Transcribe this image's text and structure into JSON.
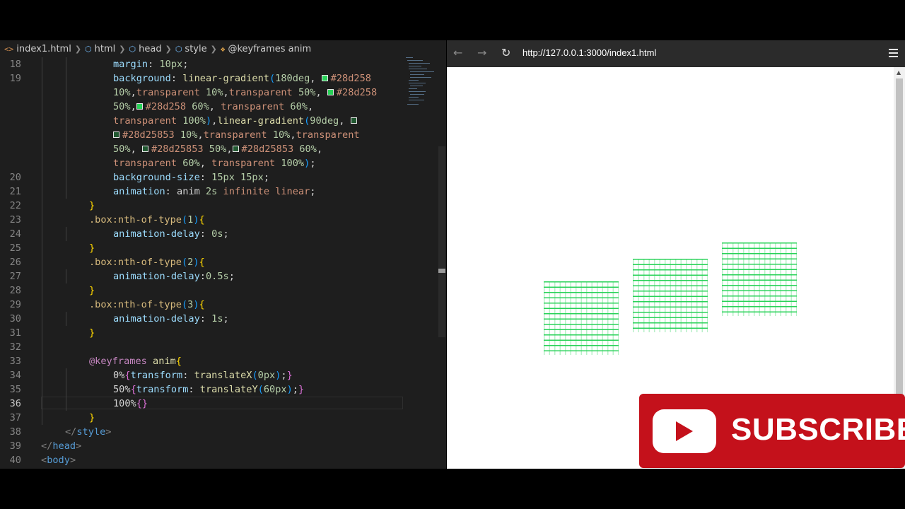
{
  "breadcrumb": {
    "file": "index1.html",
    "items": [
      "html",
      "head",
      "style",
      "@keyframes anim"
    ]
  },
  "browser": {
    "url": "http://127.0.0.1:3000/index1.html",
    "back": "←",
    "forward": "→",
    "reload": "↻"
  },
  "subscribe": {
    "label": "SUBSCRIBE"
  },
  "colors": {
    "accent_green": "#28d258",
    "subscribe_red": "#c4111b"
  },
  "code": {
    "lines": [
      {
        "no": "18",
        "cont": false,
        "indent": 3,
        "tokens": [
          [
            "prop",
            "margin"
          ],
          [
            "plain",
            ": "
          ],
          [
            "num",
            "10px"
          ],
          [
            "plain",
            ";"
          ]
        ]
      },
      {
        "no": "19",
        "cont": false,
        "indent": 3,
        "tokens": [
          [
            "prop",
            "background"
          ],
          [
            "plain",
            ": "
          ],
          [
            "fn",
            "linear-gradient"
          ],
          [
            "b3",
            "("
          ],
          [
            "num",
            "180deg"
          ],
          [
            "plain",
            ", "
          ],
          [
            "swatch",
            "#28d258"
          ],
          [
            "val",
            "#28d258"
          ]
        ]
      },
      {
        "no": "",
        "cont": true,
        "indent": 3,
        "tokens": [
          [
            "num",
            "10%"
          ],
          [
            "plain",
            ","
          ],
          [
            "val",
            "transparent "
          ],
          [
            "num",
            "10%"
          ],
          [
            "plain",
            ","
          ],
          [
            "val",
            "transparent "
          ],
          [
            "num",
            "50%"
          ],
          [
            "plain",
            ", "
          ],
          [
            "swatch",
            "#28d258"
          ],
          [
            "val",
            "#28d258"
          ]
        ]
      },
      {
        "no": "",
        "cont": true,
        "indent": 3,
        "tokens": [
          [
            "num",
            "50%"
          ],
          [
            "plain",
            ","
          ],
          [
            "swatch",
            "#28d258"
          ],
          [
            "val",
            "#28d258 "
          ],
          [
            "num",
            "60%"
          ],
          [
            "plain",
            ", "
          ],
          [
            "val",
            "transparent "
          ],
          [
            "num",
            "60%"
          ],
          [
            "plain",
            ","
          ]
        ]
      },
      {
        "no": "",
        "cont": true,
        "indent": 3,
        "tokens": [
          [
            "val",
            "transparent "
          ],
          [
            "num",
            "100%"
          ],
          [
            "b3",
            ")"
          ],
          [
            "plain",
            ","
          ],
          [
            "fn",
            "linear-gradient"
          ],
          [
            "b3",
            "("
          ],
          [
            "num",
            "90deg"
          ],
          [
            "plain",
            ", "
          ],
          [
            "swatch",
            "#28d25853"
          ]
        ]
      },
      {
        "no": "",
        "cont": true,
        "indent": 3,
        "tokens": [
          [
            "swatch",
            "#28d25853"
          ],
          [
            "val",
            "#28d25853 "
          ],
          [
            "num",
            "10%"
          ],
          [
            "plain",
            ","
          ],
          [
            "val",
            "transparent "
          ],
          [
            "num",
            "10%"
          ],
          [
            "plain",
            ","
          ],
          [
            "val",
            "transparent"
          ]
        ]
      },
      {
        "no": "",
        "cont": true,
        "indent": 3,
        "tokens": [
          [
            "num",
            "50%"
          ],
          [
            "plain",
            ", "
          ],
          [
            "swatch",
            "#28d25853"
          ],
          [
            "val",
            "#28d25853 "
          ],
          [
            "num",
            "50%"
          ],
          [
            "plain",
            ","
          ],
          [
            "swatch",
            "#28d25853"
          ],
          [
            "val",
            "#28d25853 "
          ],
          [
            "num",
            "60%"
          ],
          [
            "plain",
            ","
          ]
        ]
      },
      {
        "no": "",
        "cont": true,
        "indent": 3,
        "tokens": [
          [
            "val",
            "transparent "
          ],
          [
            "num",
            "60%"
          ],
          [
            "plain",
            ", "
          ],
          [
            "val",
            "transparent "
          ],
          [
            "num",
            "100%"
          ],
          [
            "b3",
            ")"
          ],
          [
            "plain",
            ";"
          ]
        ]
      },
      {
        "no": "20",
        "cont": false,
        "indent": 3,
        "tokens": [
          [
            "prop",
            "background-size"
          ],
          [
            "plain",
            ": "
          ],
          [
            "num",
            "15px 15px"
          ],
          [
            "plain",
            ";"
          ]
        ]
      },
      {
        "no": "21",
        "cont": false,
        "indent": 3,
        "tokens": [
          [
            "prop",
            "animation"
          ],
          [
            "plain",
            ": "
          ],
          [
            "plain",
            "anim "
          ],
          [
            "num",
            "2s "
          ],
          [
            "val",
            "infinite linear"
          ],
          [
            "plain",
            ";"
          ]
        ]
      },
      {
        "no": "22",
        "cont": false,
        "indent": 2,
        "tokens": [
          [
            "b1",
            "}"
          ]
        ]
      },
      {
        "no": "23",
        "cont": false,
        "indent": 2,
        "tokens": [
          [
            "sel",
            ".box:nth-of-type"
          ],
          [
            "b3",
            "("
          ],
          [
            "num",
            "1"
          ],
          [
            "b3",
            ")"
          ],
          [
            "b1",
            "{"
          ]
        ]
      },
      {
        "no": "24",
        "cont": false,
        "indent": 3,
        "tokens": [
          [
            "prop",
            "animation-delay"
          ],
          [
            "plain",
            ": "
          ],
          [
            "num",
            "0s"
          ],
          [
            "plain",
            ";"
          ]
        ]
      },
      {
        "no": "25",
        "cont": false,
        "indent": 2,
        "tokens": [
          [
            "b1",
            "}"
          ]
        ]
      },
      {
        "no": "26",
        "cont": false,
        "indent": 2,
        "tokens": [
          [
            "sel",
            ".box:nth-of-type"
          ],
          [
            "b3",
            "("
          ],
          [
            "num",
            "2"
          ],
          [
            "b3",
            ")"
          ],
          [
            "b1",
            "{"
          ]
        ]
      },
      {
        "no": "27",
        "cont": false,
        "indent": 3,
        "tokens": [
          [
            "prop",
            "animation-delay"
          ],
          [
            "plain",
            ":"
          ],
          [
            "num",
            "0.5s"
          ],
          [
            "plain",
            ";"
          ]
        ]
      },
      {
        "no": "28",
        "cont": false,
        "indent": 2,
        "tokens": [
          [
            "b1",
            "}"
          ]
        ]
      },
      {
        "no": "29",
        "cont": false,
        "indent": 2,
        "tokens": [
          [
            "sel",
            ".box:nth-of-type"
          ],
          [
            "b3",
            "("
          ],
          [
            "num",
            "3"
          ],
          [
            "b3",
            ")"
          ],
          [
            "b1",
            "{"
          ]
        ]
      },
      {
        "no": "30",
        "cont": false,
        "indent": 3,
        "tokens": [
          [
            "prop",
            "animation-delay"
          ],
          [
            "plain",
            ": "
          ],
          [
            "num",
            "1s"
          ],
          [
            "plain",
            ";"
          ]
        ]
      },
      {
        "no": "31",
        "cont": false,
        "indent": 2,
        "tokens": [
          [
            "b1",
            "}"
          ]
        ]
      },
      {
        "no": "32",
        "cont": false,
        "indent": 2,
        "tokens": []
      },
      {
        "no": "33",
        "cont": false,
        "indent": 2,
        "tokens": [
          [
            "kw",
            "@keyframes "
          ],
          [
            "fn",
            "anim"
          ],
          [
            "b1",
            "{"
          ]
        ]
      },
      {
        "no": "34",
        "cont": false,
        "indent": 3,
        "tokens": [
          [
            "plain",
            "0%"
          ],
          [
            "b2",
            "{"
          ],
          [
            "prop",
            "transform"
          ],
          [
            "plain",
            ": "
          ],
          [
            "fn",
            "translateX"
          ],
          [
            "b3",
            "("
          ],
          [
            "num",
            "0px"
          ],
          [
            "b3",
            ")"
          ],
          [
            "plain",
            ";"
          ],
          [
            "b2",
            "}"
          ]
        ]
      },
      {
        "no": "35",
        "cont": false,
        "indent": 3,
        "tokens": [
          [
            "plain",
            "50%"
          ],
          [
            "b2",
            "{"
          ],
          [
            "prop",
            "transform"
          ],
          [
            "plain",
            ": "
          ],
          [
            "fn",
            "translateY"
          ],
          [
            "b3",
            "("
          ],
          [
            "num",
            "60px"
          ],
          [
            "b3",
            ")"
          ],
          [
            "plain",
            ";"
          ],
          [
            "b2",
            "}"
          ]
        ]
      },
      {
        "no": "36",
        "cont": false,
        "indent": 3,
        "current": true,
        "tokens": [
          [
            "plain",
            "100%"
          ],
          [
            "b2",
            "{}"
          ]
        ]
      },
      {
        "no": "37",
        "cont": false,
        "indent": 2,
        "tokens": [
          [
            "b1",
            "}"
          ]
        ]
      },
      {
        "no": "38",
        "cont": false,
        "indent": 1,
        "tokens": [
          [
            "pun",
            "</"
          ],
          [
            "tag",
            "style"
          ],
          [
            "pun",
            ">"
          ]
        ]
      },
      {
        "no": "39",
        "cont": false,
        "indent": 0,
        "tokens": [
          [
            "pun",
            "</"
          ],
          [
            "tag",
            "head"
          ],
          [
            "pun",
            ">"
          ]
        ]
      },
      {
        "no": "40",
        "cont": false,
        "indent": 0,
        "tokens": [
          [
            "pun",
            "<"
          ],
          [
            "tag",
            "body"
          ],
          [
            "pun",
            ">"
          ]
        ]
      }
    ]
  }
}
